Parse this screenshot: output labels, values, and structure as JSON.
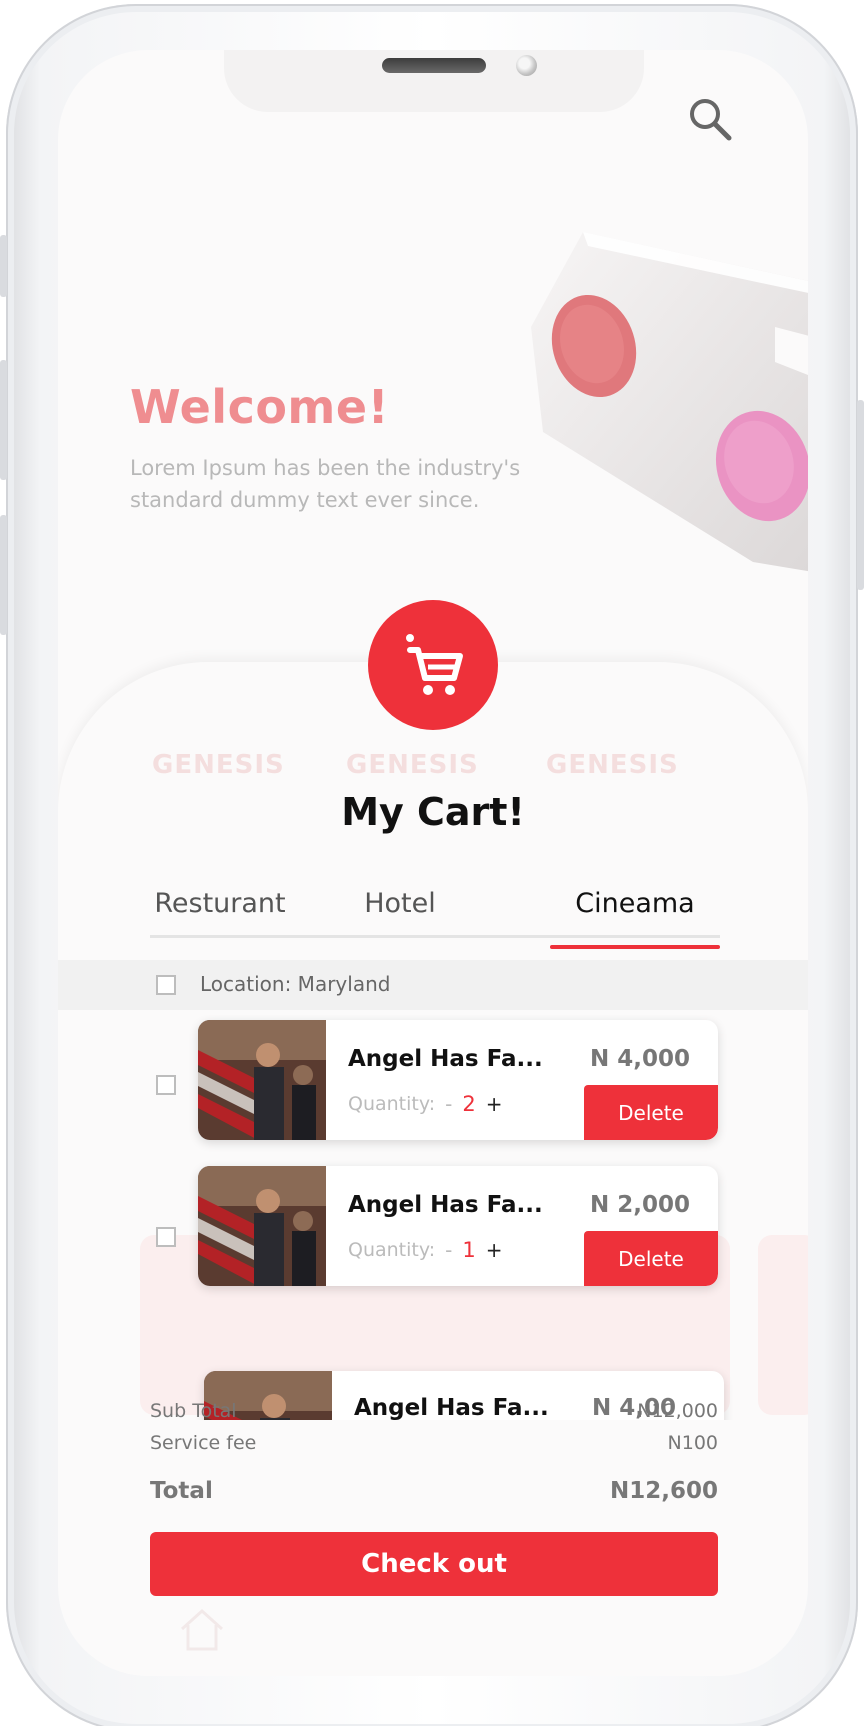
{
  "colors": {
    "accent": "#ee313a",
    "welcome": "#ef8d90",
    "screen_background": "#fbfafa"
  },
  "header": {
    "search_icon": "search-icon",
    "welcome_title": "Welcome!",
    "subtitle": "Lorem Ipsum has been the industry's standard dummy text ever since."
  },
  "cart": {
    "badge_icon": "shopping-cart-icon",
    "title": "My Cart!",
    "background_logo": "GENESIS",
    "tabs": [
      {
        "label": "Resturant",
        "active": false
      },
      {
        "label": "Hotel",
        "active": false
      },
      {
        "label": "Cineama",
        "active": true
      }
    ],
    "location": {
      "label": "Location: Maryland",
      "checked": false
    },
    "items": [
      {
        "name": "Angel Has Fa...",
        "price": "N 4,000",
        "quantity_label": "Quantity:",
        "minus": "-",
        "quantity": "2",
        "plus": "+",
        "delete_label": "Delete",
        "checked": false
      },
      {
        "name": "Angel Has Fa...",
        "price": "N 2,000",
        "quantity_label": "Quantity:",
        "minus": "-",
        "quantity": "1",
        "plus": "+",
        "delete_label": "Delete",
        "checked": false
      },
      {
        "name": "Angel Has Fa...",
        "price": "N 4,00"
      }
    ]
  },
  "summary": {
    "subtotal_label": "Sub Total",
    "subtotal_value": "N12,000",
    "service_fee_label": "Service fee",
    "service_fee_value": "N100",
    "total_label": "Total",
    "total_value": "N12,600"
  },
  "checkout": {
    "label": "Check out"
  }
}
